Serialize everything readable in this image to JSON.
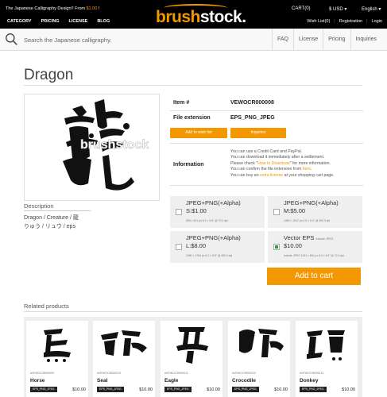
{
  "header": {
    "promo_text": "The Japanese Calligraphy Design!! From ",
    "promo_price": "$1.00",
    "promo_suffix": " !",
    "logo_brush": "brush",
    "logo_stock": "stock.",
    "nav": [
      "CATEGORY",
      "PRICING",
      "LICENSE",
      "BLOG"
    ],
    "cart": "CART(0)",
    "currency": "$ USD ▾",
    "language": "English ▾",
    "account": [
      "Wish List(0)",
      "Registration",
      "Login"
    ]
  },
  "search": {
    "placeholder": "Search the Japanese calligraphy.",
    "links": [
      "FAQ",
      "License",
      "Pricing",
      "Inquiries"
    ]
  },
  "product": {
    "title": "Dragon",
    "item_label": "Item #",
    "item_value": "VEWOCR000008",
    "ext_label": "File extension",
    "ext_value": "EPS_PNG_JPEG",
    "wishlist_button": "Add to wish list",
    "inquiries_button": "Inquiries",
    "info_label": "Information",
    "info": {
      "line1": "You can use a Credit Card and PayPal.",
      "line2": "You can download it immediately after a settlement.",
      "line3_pre": "Please check \"",
      "line3_link": "How to Download",
      "line3_post": "\" for more information.",
      "line4_pre": "You can confirm the file extension from ",
      "line4_link": "here",
      "line4_post": ".",
      "line5_pre": "You can buy an ",
      "line5_link": "extra license",
      "line5_post": " at your shopping cart page."
    },
    "watermark": "brushstock",
    "description_label": "Description",
    "description_line1": "Dragon / Creature / 龍",
    "description_line2": "りゅう / リュウ / eps",
    "options": [
      {
        "name": "JPEG+PNG(+Alpha)",
        "price": "S:$1.00",
        "detail": "595 × 421 px 8.2 × 5.8\" @ 72.0 dpi",
        "checked": false
      },
      {
        "name": "JPEG+PNG(+Alpha)",
        "price": "M:$5.00",
        "detail": "1460 × 1047 px 4.9 × 3.4\" @ 300.0 dpi",
        "checked": false
      },
      {
        "name": "JPEG+PNG(+Alpha)",
        "price": "L:$8.00",
        "detail": "2480 × 1754 px 8.2 × 5.8\" @ 300.0 dpi",
        "checked": false
      },
      {
        "name": "Vector EPS",
        "include": "Include JPEG",
        "price": "$10.00",
        "detail": "Include JPEG 1191 × 841 px 8.3 × 5.8\" @ 72.0 dpi",
        "checked": true
      }
    ],
    "add_to_cart": "Add to cart"
  },
  "related": {
    "label": "Related products",
    "items": [
      {
        "code": "#VEWOCR000009",
        "name": "Horse",
        "format": "EPS_PNG_JPEG",
        "price": "$10.00"
      },
      {
        "code": "#VEWOCR000010",
        "name": "Seal",
        "format": "EPS_PNG_JPEG",
        "price": "$10.00"
      },
      {
        "code": "#VEWOCR000011",
        "name": "Eagle",
        "format": "EPS_PNG_JPEG",
        "price": "$10.00"
      },
      {
        "code": "#VEWOCR000012",
        "name": "Crocodile",
        "format": "EPS_PNG_JPEG",
        "price": "$10.00"
      },
      {
        "code": "#VEWOCR000013",
        "name": "Donkey",
        "format": "EPS_PNG_JPEG",
        "price": "$10.00"
      }
    ]
  },
  "colors": {
    "accent": "#f39800",
    "topbar": "#000000",
    "check": "#2ea043"
  }
}
